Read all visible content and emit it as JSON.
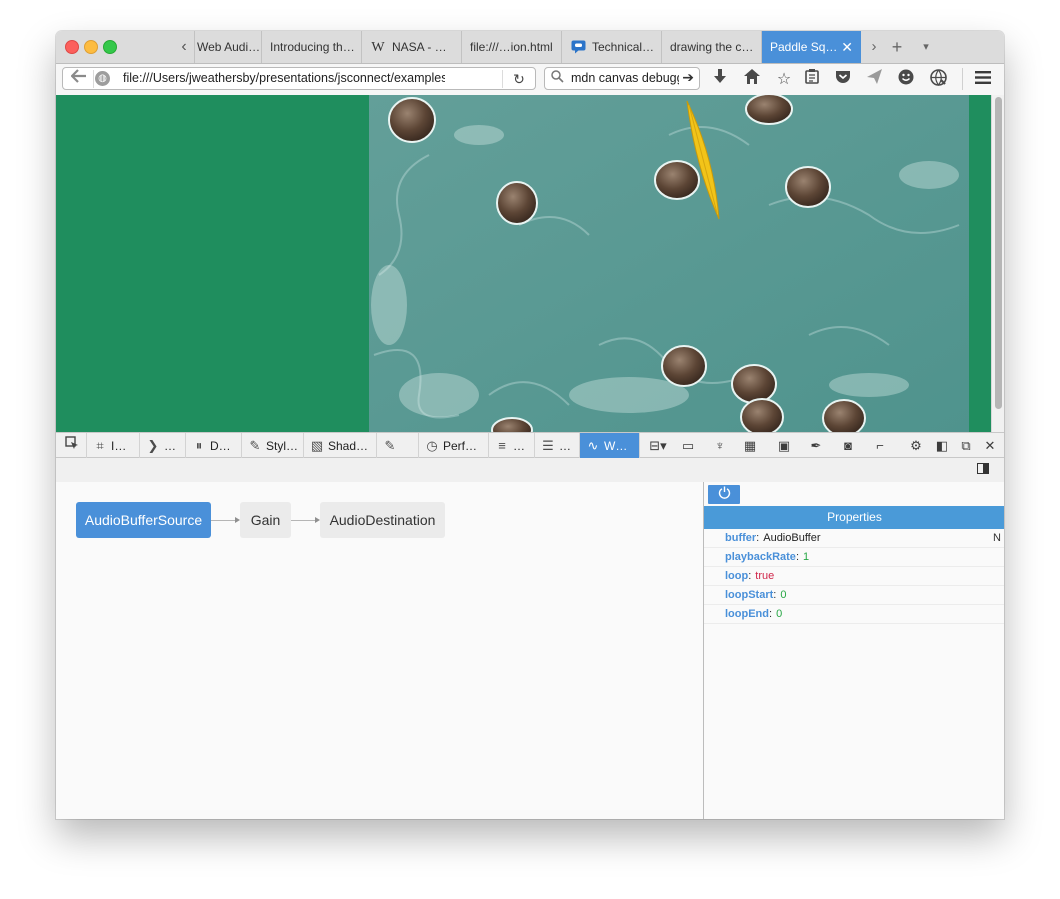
{
  "browser": {
    "tabs": [
      {
        "label": "Web Audi…",
        "icon": "audio-tab-icon"
      },
      {
        "label": "Introducing th…",
        "icon": ""
      },
      {
        "label": "NASA - …",
        "icon": "wikipedia-icon",
        "icon_glyph": "W"
      },
      {
        "label": "file:///…ion.html",
        "icon": ""
      },
      {
        "label": "Technical…",
        "icon": "chat-icon"
      },
      {
        "label": "drawing the c…",
        "icon": ""
      },
      {
        "label": "Paddle Sq…",
        "icon": "",
        "active": true
      }
    ],
    "tab_close_glyph": "✕",
    "new_tab_glyph": "+",
    "tab_overflow_glyph": "▾",
    "tab_scroll_left_glyph": "‹",
    "tab_scroll_right_glyph": "›",
    "url": "file:///Users/jweathersby/presentations/jsconnect/examples/Padd",
    "search_value": "mdn canvas debugg",
    "accent_color": "#4a90d9"
  },
  "page": {
    "background_color": "#1f8e5e",
    "river_color": "#5a9d98",
    "paddle_color": "#f5c518",
    "rock_count_visible": 10
  },
  "devtools": {
    "tools": [
      {
        "label": "I…",
        "icon": "inspector-icon"
      },
      {
        "label": "…",
        "icon": "console-icon"
      },
      {
        "label": "D…",
        "icon": "debugger-icon"
      },
      {
        "label": "Styl…",
        "icon": "style-editor-icon"
      },
      {
        "label": "Shad…",
        "icon": "shader-editor-icon"
      },
      {
        "label": "",
        "icon": "canvas-icon"
      },
      {
        "label": "Perf…",
        "icon": "performance-icon"
      },
      {
        "label": "…",
        "icon": "network-icon"
      },
      {
        "label": "…",
        "icon": "storage-icon"
      },
      {
        "label": "W…",
        "icon": "web-audio-icon",
        "active": true
      }
    ],
    "audio_graph": {
      "nodes": [
        "AudioBufferSource",
        "Gain",
        "AudioDestination"
      ],
      "selected": "AudioBufferSource"
    },
    "properties": {
      "header": "Properties",
      "rows": [
        {
          "name": "buffer",
          "value": "AudioBuffer",
          "type": "object",
          "flag": "N"
        },
        {
          "name": "playbackRate",
          "value": "1",
          "type": "number"
        },
        {
          "name": "loop",
          "value": "true",
          "type": "boolean"
        },
        {
          "name": "loopStart",
          "value": "0",
          "type": "number"
        },
        {
          "name": "loopEnd",
          "value": "0",
          "type": "number"
        }
      ]
    }
  }
}
